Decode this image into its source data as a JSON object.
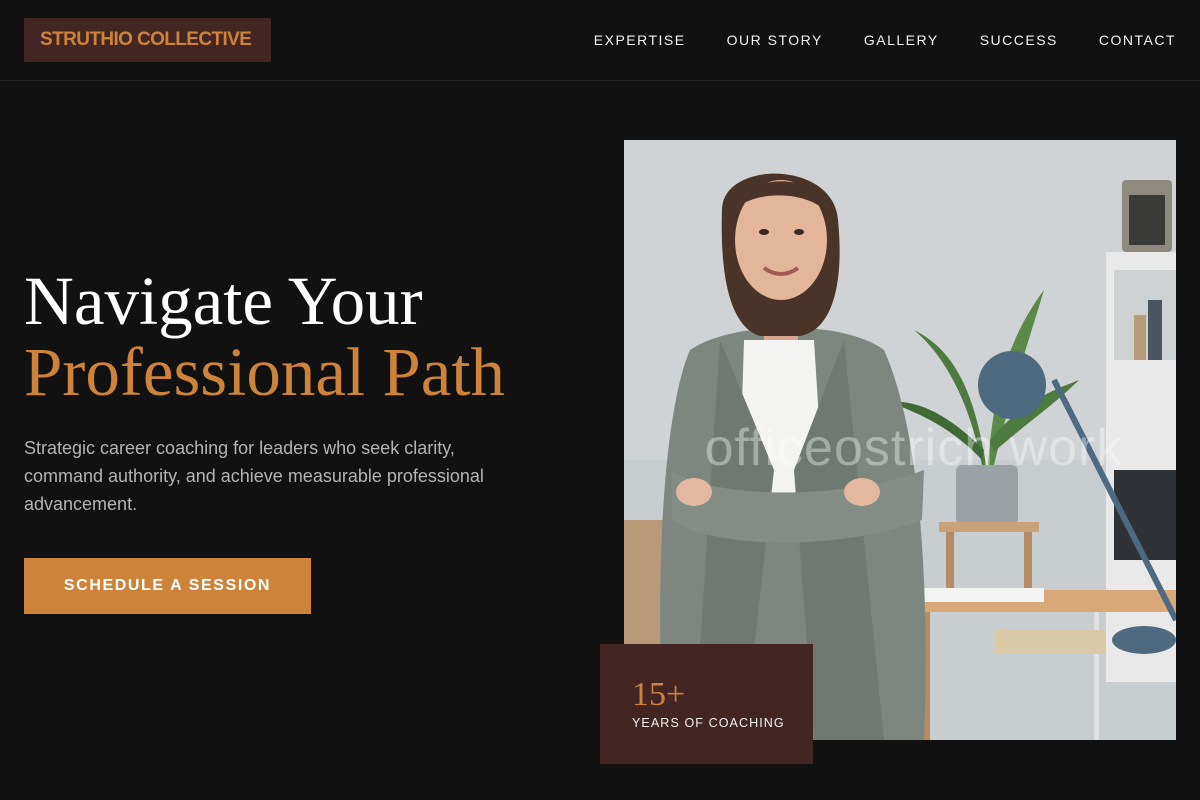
{
  "brand": {
    "name": "STRUTHIO COLLECTIVE"
  },
  "nav": {
    "items": [
      {
        "label": "EXPERTISE"
      },
      {
        "label": "OUR STORY"
      },
      {
        "label": "GALLERY"
      },
      {
        "label": "SUCCESS"
      },
      {
        "label": "CONTACT"
      }
    ]
  },
  "hero": {
    "title_line1": "Navigate Your",
    "title_line2": "Professional Path",
    "subtitle": "Strategic career coaching for leaders who seek clarity, command authority, and achieve measurable professional advancement.",
    "cta_label": "SCHEDULE A SESSION"
  },
  "photo": {
    "watermark": "officeostrich work"
  },
  "stat": {
    "value": "15+",
    "label": "YEARS OF COACHING"
  },
  "colors": {
    "background": "#111111",
    "accent": "#cd833a",
    "brand_bg": "#432624",
    "text_primary": "#ffffff",
    "text_muted": "#b4b4b4"
  }
}
